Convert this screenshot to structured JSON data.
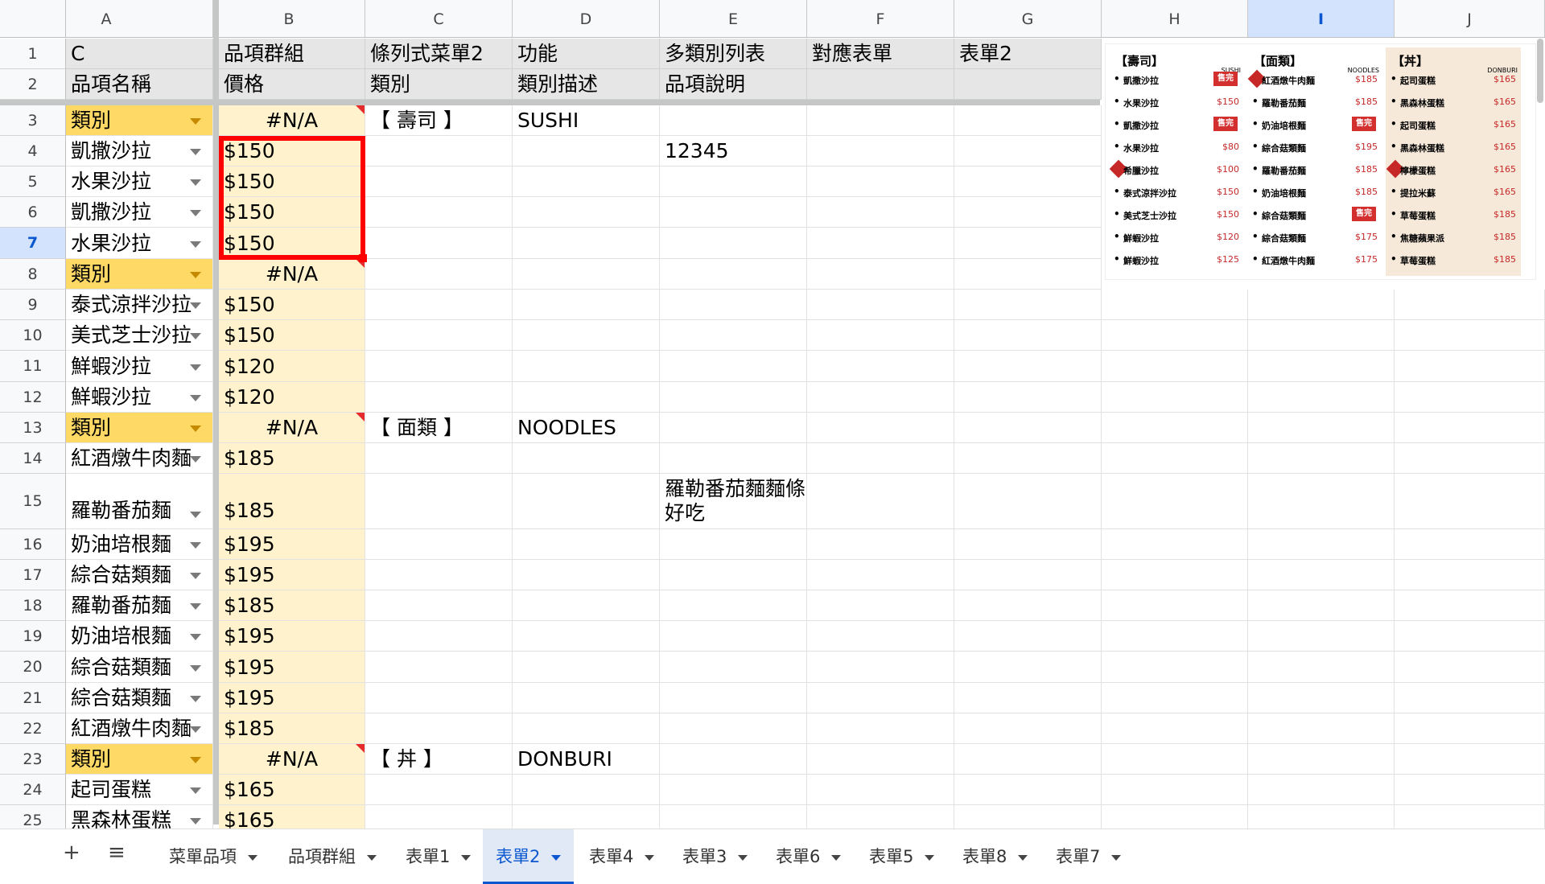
{
  "columns": [
    "A",
    "B",
    "C",
    "D",
    "E",
    "F",
    "G",
    "H",
    "I",
    "J"
  ],
  "selected_column": "I",
  "selected_row": "7",
  "rows": [
    {
      "n": "1",
      "A": "C",
      "B": "品項群組",
      "C": "條列式菜單2",
      "D": "功能",
      "E": "多類別列表",
      "F": "對應表單",
      "G": "表單2"
    },
    {
      "n": "2",
      "A": "品項名稱",
      "B": "價格",
      "C": "類別",
      "D": "類別描述",
      "E": "品項說明",
      "F": "",
      "G": ""
    },
    {
      "n": "3",
      "A": "類別",
      "B": "#N/A",
      "C": "【 壽司 】",
      "D": "SUSHI",
      "E": ""
    },
    {
      "n": "4",
      "A": "凱撒沙拉",
      "B": "$150",
      "C": "",
      "D": "",
      "E": "12345"
    },
    {
      "n": "5",
      "A": "水果沙拉",
      "B": "$150",
      "C": "",
      "D": "",
      "E": ""
    },
    {
      "n": "6",
      "A": "凱撒沙拉",
      "B": "$150",
      "C": "",
      "D": "",
      "E": ""
    },
    {
      "n": "7",
      "A": "水果沙拉",
      "B": "$150",
      "C": "",
      "D": "",
      "E": ""
    },
    {
      "n": "8",
      "A": "類別",
      "B": "#N/A",
      "C": "",
      "D": "",
      "E": ""
    },
    {
      "n": "9",
      "A": "泰式涼拌沙拉",
      "B": "$150",
      "C": "",
      "D": "",
      "E": ""
    },
    {
      "n": "10",
      "A": "美式芝士沙拉",
      "B": "$150",
      "C": "",
      "D": "",
      "E": ""
    },
    {
      "n": "11",
      "A": "鮮蝦沙拉",
      "B": "$120",
      "C": "",
      "D": "",
      "E": ""
    },
    {
      "n": "12",
      "A": "鮮蝦沙拉",
      "B": "$120",
      "C": "",
      "D": "",
      "E": ""
    },
    {
      "n": "13",
      "A": "類別",
      "B": "#N/A",
      "C": "【 面類 】",
      "D": "NOODLES",
      "E": ""
    },
    {
      "n": "14",
      "A": "紅酒燉牛肉麵",
      "B": "$185",
      "C": "",
      "D": "",
      "E": ""
    },
    {
      "n": "15",
      "A": "羅勒番茄麵",
      "B": "$185",
      "C": "",
      "D": "",
      "E": "羅勒番茄麵麵條好吃"
    },
    {
      "n": "16",
      "A": "奶油培根麵",
      "B": "$195",
      "C": "",
      "D": "",
      "E": ""
    },
    {
      "n": "17",
      "A": "綜合菇類麵",
      "B": "$195",
      "C": "",
      "D": "",
      "E": ""
    },
    {
      "n": "18",
      "A": "羅勒番茄麵",
      "B": "$185",
      "C": "",
      "D": "",
      "E": ""
    },
    {
      "n": "19",
      "A": "奶油培根麵",
      "B": "$195",
      "C": "",
      "D": "",
      "E": ""
    },
    {
      "n": "20",
      "A": "綜合菇類麵",
      "B": "$195",
      "C": "",
      "D": "",
      "E": ""
    },
    {
      "n": "21",
      "A": "綜合菇類麵",
      "B": "$195",
      "C": "",
      "D": "",
      "E": ""
    },
    {
      "n": "22",
      "A": "紅酒燉牛肉麵",
      "B": "$185",
      "C": "",
      "D": "",
      "E": ""
    },
    {
      "n": "23",
      "A": "類別",
      "B": "#N/A",
      "C": "【 丼 】",
      "D": "DONBURI",
      "E": ""
    },
    {
      "n": "24",
      "A": "起司蛋糕",
      "B": "$165",
      "C": "",
      "D": "",
      "E": ""
    },
    {
      "n": "25",
      "A": "黑森林蛋糕",
      "B": "$165",
      "C": "",
      "D": "",
      "E": ""
    }
  ],
  "menu_image": {
    "sections": [
      {
        "title": "【壽司】",
        "subtitle": "SUSHI",
        "items": [
          {
            "name": "凱撒沙拉",
            "price": "",
            "badge": "售完",
            "hot": false
          },
          {
            "name": "水果沙拉",
            "price": "$150",
            "badge": "",
            "hot": false
          },
          {
            "name": "凱撒沙拉",
            "price": "",
            "badge": "售完",
            "hot": false
          },
          {
            "name": "水果沙拉",
            "price": "$80",
            "badge": "",
            "hot": false
          },
          {
            "name": "希臘沙拉",
            "price": "$100",
            "badge": "",
            "hot": true
          },
          {
            "name": "泰式涼拌沙拉",
            "price": "$150",
            "badge": "",
            "hot": false
          },
          {
            "name": "美式芝士沙拉",
            "price": "$150",
            "badge": "",
            "hot": false
          },
          {
            "name": "鮮蝦沙拉",
            "price": "$120",
            "badge": "",
            "hot": false
          },
          {
            "name": "鮮蝦沙拉",
            "price": "$125",
            "badge": "",
            "hot": false
          }
        ]
      },
      {
        "title": "【面類】",
        "subtitle": "NOODLES",
        "items": [
          {
            "name": "紅酒燉牛肉麵",
            "price": "$185",
            "badge": "",
            "hot": true
          },
          {
            "name": "羅勒番茄麵",
            "price": "$185",
            "badge": "",
            "hot": false
          },
          {
            "name": "奶油培根麵",
            "price": "",
            "badge": "售完",
            "hot": false
          },
          {
            "name": "綜合菇類麵",
            "price": "$195",
            "badge": "",
            "hot": false
          },
          {
            "name": "羅勒番茄麵",
            "price": "$185",
            "badge": "",
            "hot": false
          },
          {
            "name": "奶油培根麵",
            "price": "$185",
            "badge": "",
            "hot": false
          },
          {
            "name": "綜合菇類麵",
            "price": "",
            "badge": "售完",
            "hot": false
          },
          {
            "name": "綜合菇類麵",
            "price": "$175",
            "badge": "",
            "hot": false
          },
          {
            "name": "紅酒燉牛肉麵",
            "price": "$175",
            "badge": "",
            "hot": false
          }
        ]
      },
      {
        "title": "【丼】",
        "subtitle": "DONBURI",
        "items": [
          {
            "name": "起司蛋糕",
            "price": "$165",
            "badge": "",
            "hot": false
          },
          {
            "name": "黑森林蛋糕",
            "price": "$165",
            "badge": "",
            "hot": false
          },
          {
            "name": "起司蛋糕",
            "price": "$165",
            "badge": "",
            "hot": false
          },
          {
            "name": "黑森林蛋糕",
            "price": "$165",
            "badge": "",
            "hot": false
          },
          {
            "name": "檸檬蛋糕",
            "price": "$165",
            "badge": "",
            "hot": true
          },
          {
            "name": "提拉米蘇",
            "price": "$165",
            "badge": "",
            "hot": false
          },
          {
            "name": "草莓蛋糕",
            "price": "$185",
            "badge": "",
            "hot": false
          },
          {
            "name": "焦糖蘋果派",
            "price": "$185",
            "badge": "",
            "hot": false
          },
          {
            "name": "草莓蛋糕",
            "price": "$185",
            "badge": "",
            "hot": false
          }
        ]
      }
    ]
  },
  "tabs": {
    "add_icon": "+",
    "list_icon": "≡",
    "sheets": [
      "菜單品項",
      "品項群組",
      "表單1",
      "表單2",
      "表單4",
      "表單3",
      "表單6",
      "表單5",
      "表單8",
      "表單7"
    ],
    "active": "表單2"
  },
  "colors": {
    "selection": "#ff0000",
    "tag_fill": "#ffd966",
    "price_fill": "#fff2cc",
    "active_tab": "#0b57d0"
  }
}
